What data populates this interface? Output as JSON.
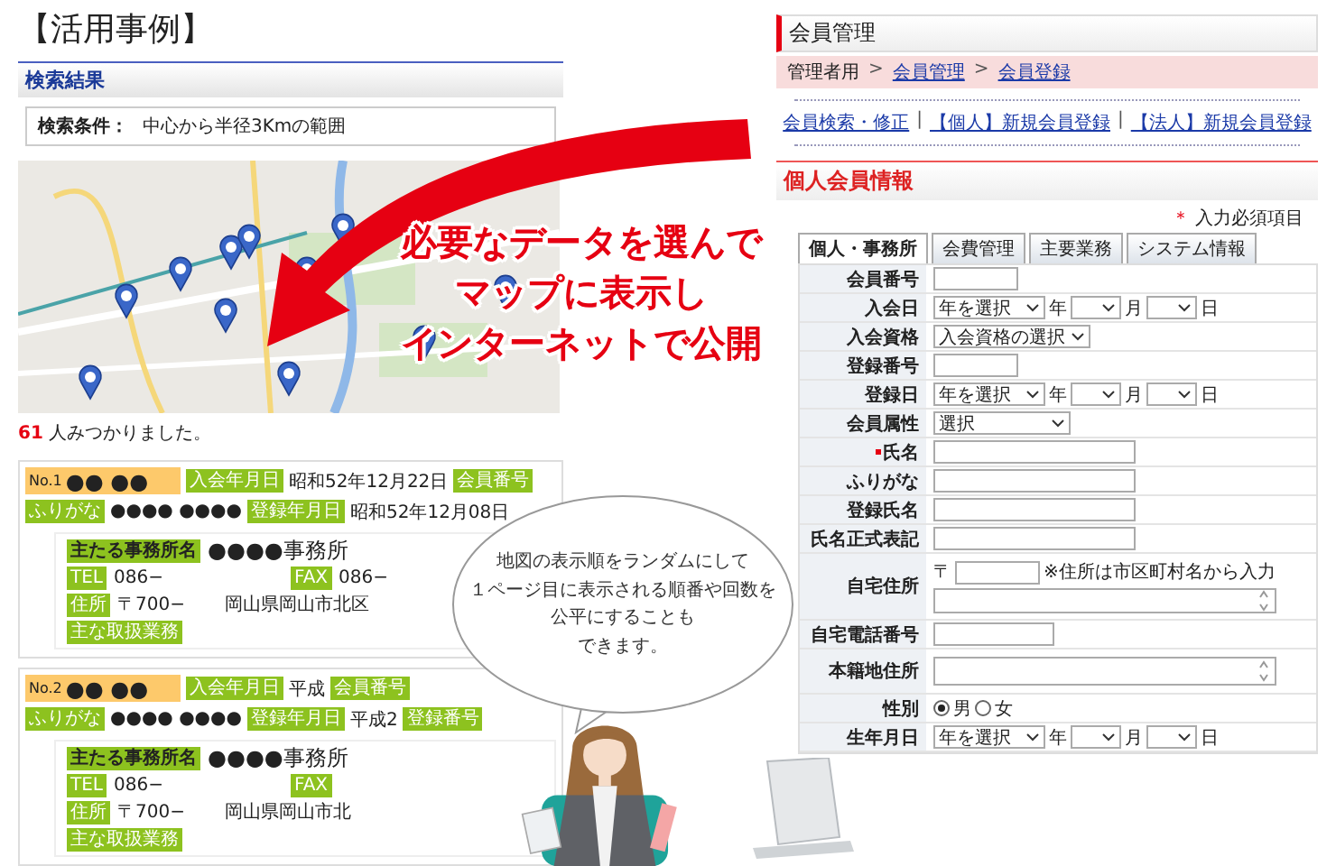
{
  "left": {
    "title": "【活用事例】",
    "section_heading": "検索結果",
    "condition": {
      "label": "検索条件：",
      "value": "中心から半径3Kmの範囲"
    },
    "result": {
      "count": "61",
      "suffix": "人みつかりました。"
    },
    "cards": [
      {
        "number": "No.1",
        "name": "●● ●●",
        "header_fields": [
          {
            "tag": "入会年月日",
            "value": "昭和52年12月22日"
          },
          {
            "tag": "会員番号"
          }
        ],
        "sub_fields": [
          {
            "tag": "ふりがな",
            "value": "●●●● ●●●●"
          },
          {
            "tag": "登録年月日",
            "value": "昭和52年12月08日"
          }
        ],
        "office": {
          "tag": "主たる事務所名",
          "value": "●●●●事務所"
        },
        "tel": {
          "tag": "TEL",
          "value": "086−"
        },
        "fax": {
          "tag": "FAX",
          "value": "086−"
        },
        "address": {
          "tag": "住所",
          "postal": "〒700−",
          "value": "岡山県岡山市北区"
        },
        "business_tag": "主な取扱業務"
      },
      {
        "number": "No.2",
        "name": "●● ●●",
        "header_fields": [
          {
            "tag": "入会年月日",
            "value": "平成"
          },
          {
            "tag": "会員番号"
          }
        ],
        "sub_fields": [
          {
            "tag": "ふりがな",
            "value": "●●●● ●●●●"
          },
          {
            "tag": "登録年月日",
            "value": "平成2"
          },
          {
            "tag": "登録番号"
          }
        ],
        "office": {
          "tag": "主たる事務所名",
          "value": "●●●●事務所"
        },
        "tel": {
          "tag": "TEL",
          "value": "086−"
        },
        "fax": {
          "tag": "FAX"
        },
        "address": {
          "tag": "住所",
          "postal": "〒700−",
          "value": "岡山県岡山市北"
        },
        "business_tag": "主な取扱業務"
      }
    ]
  },
  "right": {
    "title": "会員管理",
    "breadcrumb": [
      {
        "kind": "text",
        "text": "管理者用"
      },
      {
        "kind": "sep",
        "text": ">"
      },
      {
        "kind": "link",
        "text": "会員管理"
      },
      {
        "kind": "sep",
        "text": ">"
      },
      {
        "kind": "link",
        "text": "会員登録"
      }
    ],
    "links": [
      {
        "kind": "link",
        "text": "会員検索・修正"
      },
      {
        "kind": "sep",
        "text": "|"
      },
      {
        "kind": "link",
        "text": "【個人】新規会員登録"
      },
      {
        "kind": "sep",
        "text": "|"
      },
      {
        "kind": "link",
        "text": "【法人】新規会員登録"
      }
    ],
    "section_title": "個人会員情報",
    "required_note": {
      "mark": "＊",
      "text": "入力必須項目"
    },
    "tabs": [
      {
        "label": "個人・事務所",
        "selected": true
      },
      {
        "label": "会費管理",
        "selected": false
      },
      {
        "label": "主要業務",
        "selected": false
      },
      {
        "label": "システム情報",
        "selected": false
      }
    ],
    "rows": [
      {
        "label": "会員番号",
        "kind": "number",
        "required": false
      },
      {
        "label": "入会日",
        "kind": "date",
        "required": false,
        "placeholder": "年を選択",
        "units": [
          "年",
          "月",
          "日"
        ]
      },
      {
        "label": "入会資格",
        "kind": "select",
        "required": false,
        "value": "入会資格の選択"
      },
      {
        "label": "登録番号",
        "kind": "number",
        "required": false
      },
      {
        "label": "登録日",
        "kind": "date",
        "required": false,
        "placeholder": "年を選択",
        "units": [
          "年",
          "月",
          "日"
        ]
      },
      {
        "label": "会員属性",
        "kind": "select",
        "required": false,
        "value": "選択"
      },
      {
        "label": "氏名",
        "kind": "text",
        "required": true
      },
      {
        "label": "ふりがな",
        "kind": "text",
        "required": false
      },
      {
        "label": "登録氏名",
        "kind": "text",
        "required": false
      },
      {
        "label": "氏名正式表記",
        "kind": "text",
        "required": false
      },
      {
        "label": "自宅住所",
        "kind": "address",
        "required": false,
        "postal_mark": "〒",
        "note": "※住所は市区町村名から入力"
      },
      {
        "label": "自宅電話番号",
        "kind": "phone",
        "required": false
      },
      {
        "label": "本籍地住所",
        "kind": "textarea",
        "required": false
      },
      {
        "label": "性別",
        "kind": "radio",
        "required": false,
        "options": [
          {
            "label": "男",
            "selected": true
          },
          {
            "label": "女",
            "selected": false
          }
        ]
      },
      {
        "label": "生年月日",
        "kind": "date",
        "required": false,
        "placeholder": "年を選択",
        "units": [
          "年",
          "月",
          "日"
        ]
      }
    ]
  },
  "headline": {
    "lines": [
      "必要なデータを選んで",
      "マップに表示し",
      "インターネットで公開"
    ]
  },
  "bubble": {
    "lines": [
      "地図の表示順をランダムにして",
      "１ページ目に表示される順番や回数を",
      "公平にすることも",
      "できます。"
    ]
  }
}
